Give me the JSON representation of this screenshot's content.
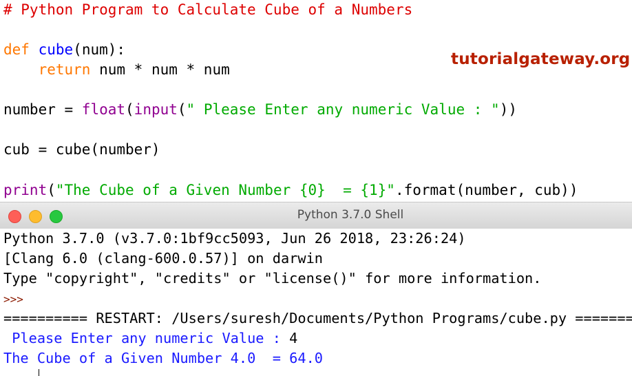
{
  "editor": {
    "comment": "# Python Program to Calculate Cube of a Numbers",
    "line_def": {
      "kw": "def",
      "fn": "cube",
      "rest": "(num):"
    },
    "line_return": {
      "indent": "    ",
      "kw": "return",
      "rest": " num * num * num"
    },
    "line_number": {
      "pre": "number = ",
      "b1": "float",
      "p1": "(",
      "b2": "input",
      "p2": "(",
      "str": "\" Please Enter any numeric Value : \"",
      "post": "))"
    },
    "line_cub": "cub = cube(number)",
    "line_print": {
      "bi": "print",
      "p1": "(",
      "str": "\"The Cube of a Given Number {0}  = {1}\"",
      "post": ".format(number, cub))"
    }
  },
  "watermark": "tutorialgateway.org",
  "window": {
    "title": "Python 3.7.0 Shell"
  },
  "colors": {
    "close": "#fe5f57",
    "minimize": "#febc2e",
    "maximize": "#28c840"
  },
  "shell": {
    "banner1": "Python 3.7.0 (v3.7.0:1bf9cc5093, Jun 26 2018, 23:26:24)",
    "banner2": "[Clang 6.0 (clang-600.0.57)] on darwin",
    "banner3": "Type \"copyright\", \"credits\" or \"license()\" for more information.",
    "prompt": ">>>",
    "restart": "========== RESTART: /Users/suresh/Documents/Python Programs/cube.py ==========",
    "input_prompt": " Please Enter any numeric Value : ",
    "input_value": "4",
    "result": "The Cube of a Given Number 4.0  = 64.0"
  }
}
